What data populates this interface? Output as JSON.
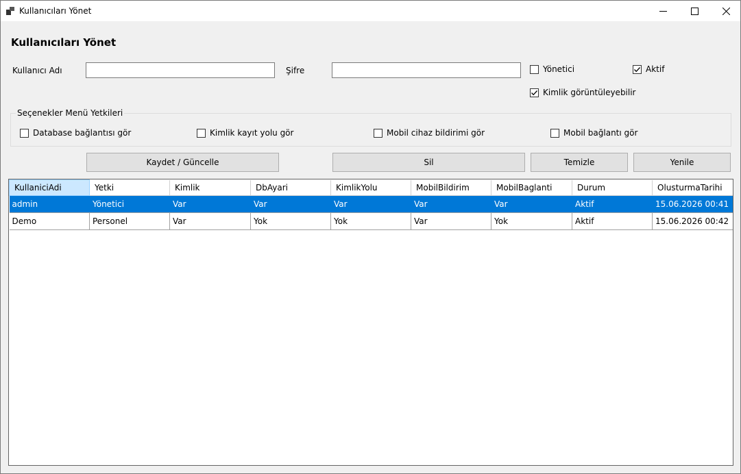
{
  "window": {
    "title": "Kullanıcıları Yönet"
  },
  "form": {
    "heading": "Kullanıcıları Yönet",
    "username_label": "Kullanıcı Adı",
    "username_value": "",
    "password_label": "Şifre",
    "password_value": "",
    "admin_checkbox": {
      "label": "Yönetici",
      "checked": false
    },
    "active_checkbox": {
      "label": "Aktif",
      "checked": true
    },
    "identity_view_checkbox": {
      "label": "Kimlik görüntüleyebilir",
      "checked": true
    }
  },
  "permissions": {
    "title": "Seçenekler Menü Yetkileri",
    "items": [
      {
        "label": "Database bağlantısı gör",
        "checked": false
      },
      {
        "label": "Kimlik kayıt yolu gör",
        "checked": false
      },
      {
        "label": "Mobil cihaz bildirimi gör",
        "checked": false
      },
      {
        "label": "Mobil bağlantı gör",
        "checked": false
      }
    ]
  },
  "buttons": {
    "save": "Kaydet / Güncelle",
    "delete": "Sil",
    "clear": "Temizle",
    "refresh": "Yenile"
  },
  "table": {
    "columns": [
      "KullaniciAdi",
      "Yetki",
      "Kimlik",
      "DbAyari",
      "KimlikYolu",
      "MobilBildirim",
      "MobilBaglanti",
      "Durum",
      "OlusturmaTarihi"
    ],
    "rows": [
      [
        "admin",
        "Yönetici",
        "Var",
        "Var",
        "Var",
        "Var",
        "Var",
        "Aktif",
        "15.06.2026 00:41"
      ],
      [
        "Demo",
        "Personel",
        "Var",
        "Yok",
        "Yok",
        "Var",
        "Yok",
        "Aktif",
        "15.06.2026 00:42"
      ]
    ],
    "selected_row": 0
  },
  "colors": {
    "selection": "#0078d7",
    "header_selected": "#cce8ff",
    "window_bg": "#f0f0f0"
  }
}
